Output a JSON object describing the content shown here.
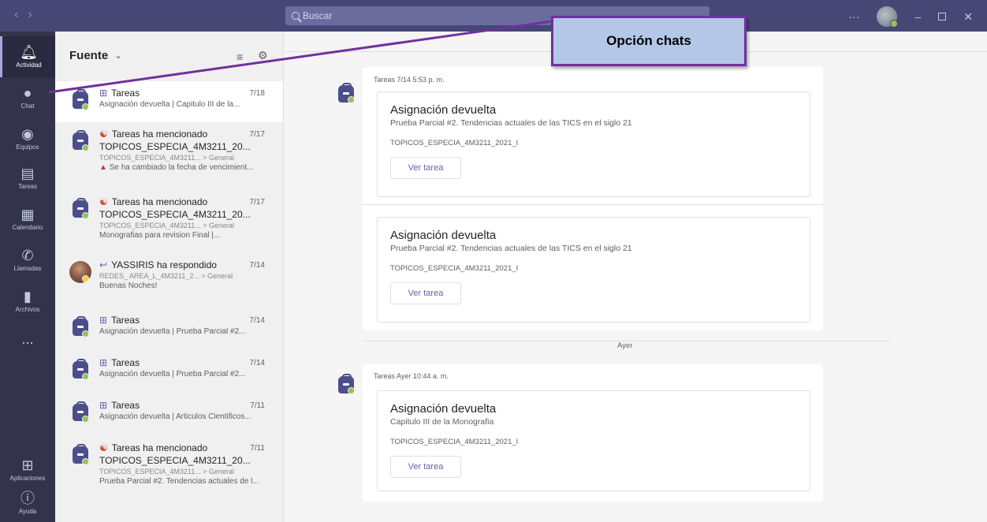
{
  "titlebar": {
    "search_placeholder": "Buscar",
    "more": "···"
  },
  "rail": [
    {
      "label": "Actividad",
      "icon": "bell-icon"
    },
    {
      "label": "Chat",
      "icon": "chat-icon"
    },
    {
      "label": "Equipos",
      "icon": "teams-icon"
    },
    {
      "label": "Tareas",
      "icon": "assignments-icon"
    },
    {
      "label": "Calendario",
      "icon": "calendar-icon"
    },
    {
      "label": "Llamadas",
      "icon": "phone-icon"
    },
    {
      "label": "Archivos",
      "icon": "file-icon"
    },
    {
      "label": "...",
      "icon": "more-icon"
    },
    {
      "label": "Aplicaciones",
      "icon": "apps-icon"
    },
    {
      "label": "Ayuda",
      "icon": "help-icon"
    }
  ],
  "list": {
    "title": "Fuente",
    "items": [
      {
        "name": "Tareas",
        "date": "7/18",
        "line1": "Asignación devuelta | Capitulo III de la...",
        "line2": "",
        "line3": ""
      },
      {
        "name": "Tareas ha mencionado",
        "date": "7/17",
        "line1": "TOPICOS_ESPECIA_4M3211_20...",
        "line2": "TOPICOS_ESPECIA_4M3211... > General",
        "line3": "Se ha cambiado la fecha de vencimient..."
      },
      {
        "name": "Tareas ha mencionado",
        "date": "7/17",
        "line1": "TOPICOS_ESPECIA_4M3211_20...",
        "line2": "TOPICOS_ESPECIA_4M3211... > General",
        "line3": "Monografias para revision Final |..."
      },
      {
        "name": "YASSIRIS ha respondido",
        "date": "7/14",
        "line1": "REDES_ AREA_L_4M3211_2... > General",
        "line2": "Buenas Noches!",
        "line3": ""
      },
      {
        "name": "Tareas",
        "date": "7/14",
        "line1": "Asignación devuelta | Prueba Parcial #2...",
        "line2": "",
        "line3": ""
      },
      {
        "name": "Tareas",
        "date": "7/14",
        "line1": "Asignación devuelta | Prueba Parcial #2...",
        "line2": "",
        "line3": ""
      },
      {
        "name": "Tareas",
        "date": "7/11",
        "line1": "Asignación devuelta | Articulos Cientificos...",
        "line2": "",
        "line3": ""
      },
      {
        "name": "Tareas ha mencionado",
        "date": "7/11",
        "line1": "TOPICOS_ESPECIA_4M3211_20...",
        "line2": "TOPICOS_ESPECIA_4M3211... > General",
        "line3": "Prueba Parcial #2. Tendencias actuales de l..."
      }
    ]
  },
  "main": {
    "msg1_meta": "Tareas  7/14 5:53 p. m.",
    "msg2_meta": "Tareas  Ayer 10:44 a. m.",
    "day_label": "Ayer",
    "cards": [
      {
        "title": "Asignación devuelta",
        "sub": "Prueba Parcial #2. Tendencias actuales de las TICS en el siglo 21",
        "team": "TOPICOS_ESPECIA_4M3211_2021_I",
        "button": "Ver tarea"
      },
      {
        "title": "Asignación devuelta",
        "sub": "Prueba Parcial #2. Tendencias actuales de las TICS en el siglo 21",
        "team": "TOPICOS_ESPECIA_4M3211_2021_I",
        "button": "Ver tarea"
      },
      {
        "title": "Asignación devuelta",
        "sub": "Capitulo III de la Monografia",
        "team": "TOPICOS_ESPECIA_4M3211_2021_I",
        "button": "Ver tarea"
      }
    ]
  },
  "callout": {
    "text": "Opción chats",
    "border_color": "#7030a0",
    "fill_color": "#b4c7e7"
  },
  "colors": {
    "titlebar": "#464775",
    "rail": "#33344a",
    "accent": "#6264a7"
  }
}
